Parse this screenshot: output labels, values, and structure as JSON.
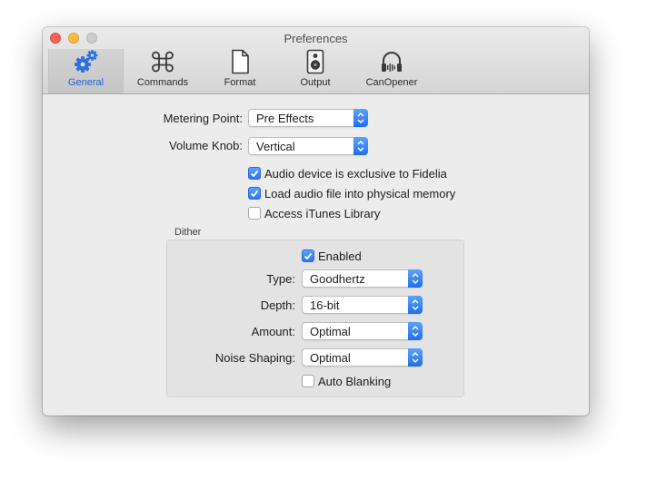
{
  "window": {
    "title": "Preferences"
  },
  "toolbar": {
    "items": [
      {
        "label": "General",
        "icon": "gears-icon",
        "selected": true
      },
      {
        "label": "Commands",
        "icon": "command-key-icon",
        "selected": false
      },
      {
        "label": "Format",
        "icon": "document-icon",
        "selected": false
      },
      {
        "label": "Output",
        "icon": "speaker-icon",
        "selected": false
      },
      {
        "label": "CanOpener",
        "icon": "headphones-icon",
        "selected": false
      }
    ]
  },
  "general": {
    "metering_point": {
      "label": "Metering Point:",
      "value": "Pre Effects"
    },
    "volume_knob": {
      "label": "Volume Knob:",
      "value": "Vertical"
    },
    "options": [
      {
        "label": "Audio device is exclusive to Fidelia",
        "checked": true
      },
      {
        "label": "Load audio file into physical memory",
        "checked": true
      },
      {
        "label": "Access iTunes Library",
        "checked": false
      }
    ]
  },
  "dither": {
    "group_label": "Dither",
    "enabled": {
      "label": "Enabled",
      "checked": true
    },
    "type": {
      "label": "Type:",
      "value": "Goodhertz"
    },
    "depth": {
      "label": "Depth:",
      "value": "16-bit"
    },
    "amount": {
      "label": "Amount:",
      "value": "Optimal"
    },
    "noise_shaping": {
      "label": "Noise Shaping:",
      "value": "Optimal"
    },
    "auto_blanking": {
      "label": "Auto Blanking",
      "checked": false
    }
  },
  "colors": {
    "accent": "#1f6ef0",
    "close": "#fc605c",
    "minimize": "#fdbc40",
    "zoom_disabled": "#cdcdcd"
  }
}
